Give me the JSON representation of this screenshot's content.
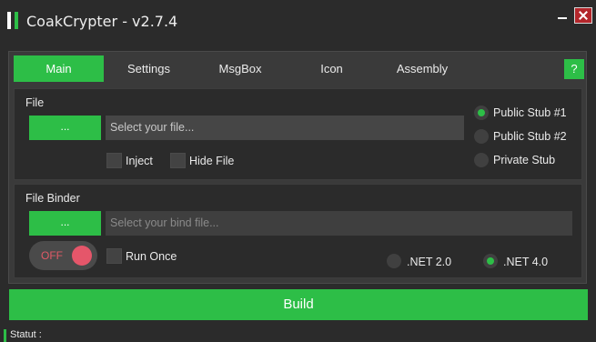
{
  "window": {
    "title": "CoakCrypter - v2.7.4"
  },
  "tabs": [
    "Main",
    "Settings",
    "MsgBox",
    "Icon",
    "Assembly"
  ],
  "help_label": "?",
  "file_group": {
    "label": "File",
    "browse_label": "...",
    "placeholder": "Select your file...",
    "inject_label": "Inject",
    "hide_file_label": "Hide File",
    "stubs": [
      "Public Stub #1",
      "Public Stub #2",
      "Private Stub"
    ],
    "selected_stub": "Public Stub #1"
  },
  "binder_group": {
    "label": "File Binder",
    "browse_label": "...",
    "placeholder": "Select your bind file...",
    "toggle_label": "OFF",
    "run_once_label": "Run Once",
    "net2_label": ".NET 2.0",
    "net4_label": ".NET 4.0",
    "selected_net": ".NET 4.0"
  },
  "build_label": "Build",
  "status_label": "Statut :",
  "colors": {
    "accent": "#2dbe47",
    "close": "#b3262b",
    "toggle_off": "#e5566a",
    "background": "#2b2b2b"
  }
}
